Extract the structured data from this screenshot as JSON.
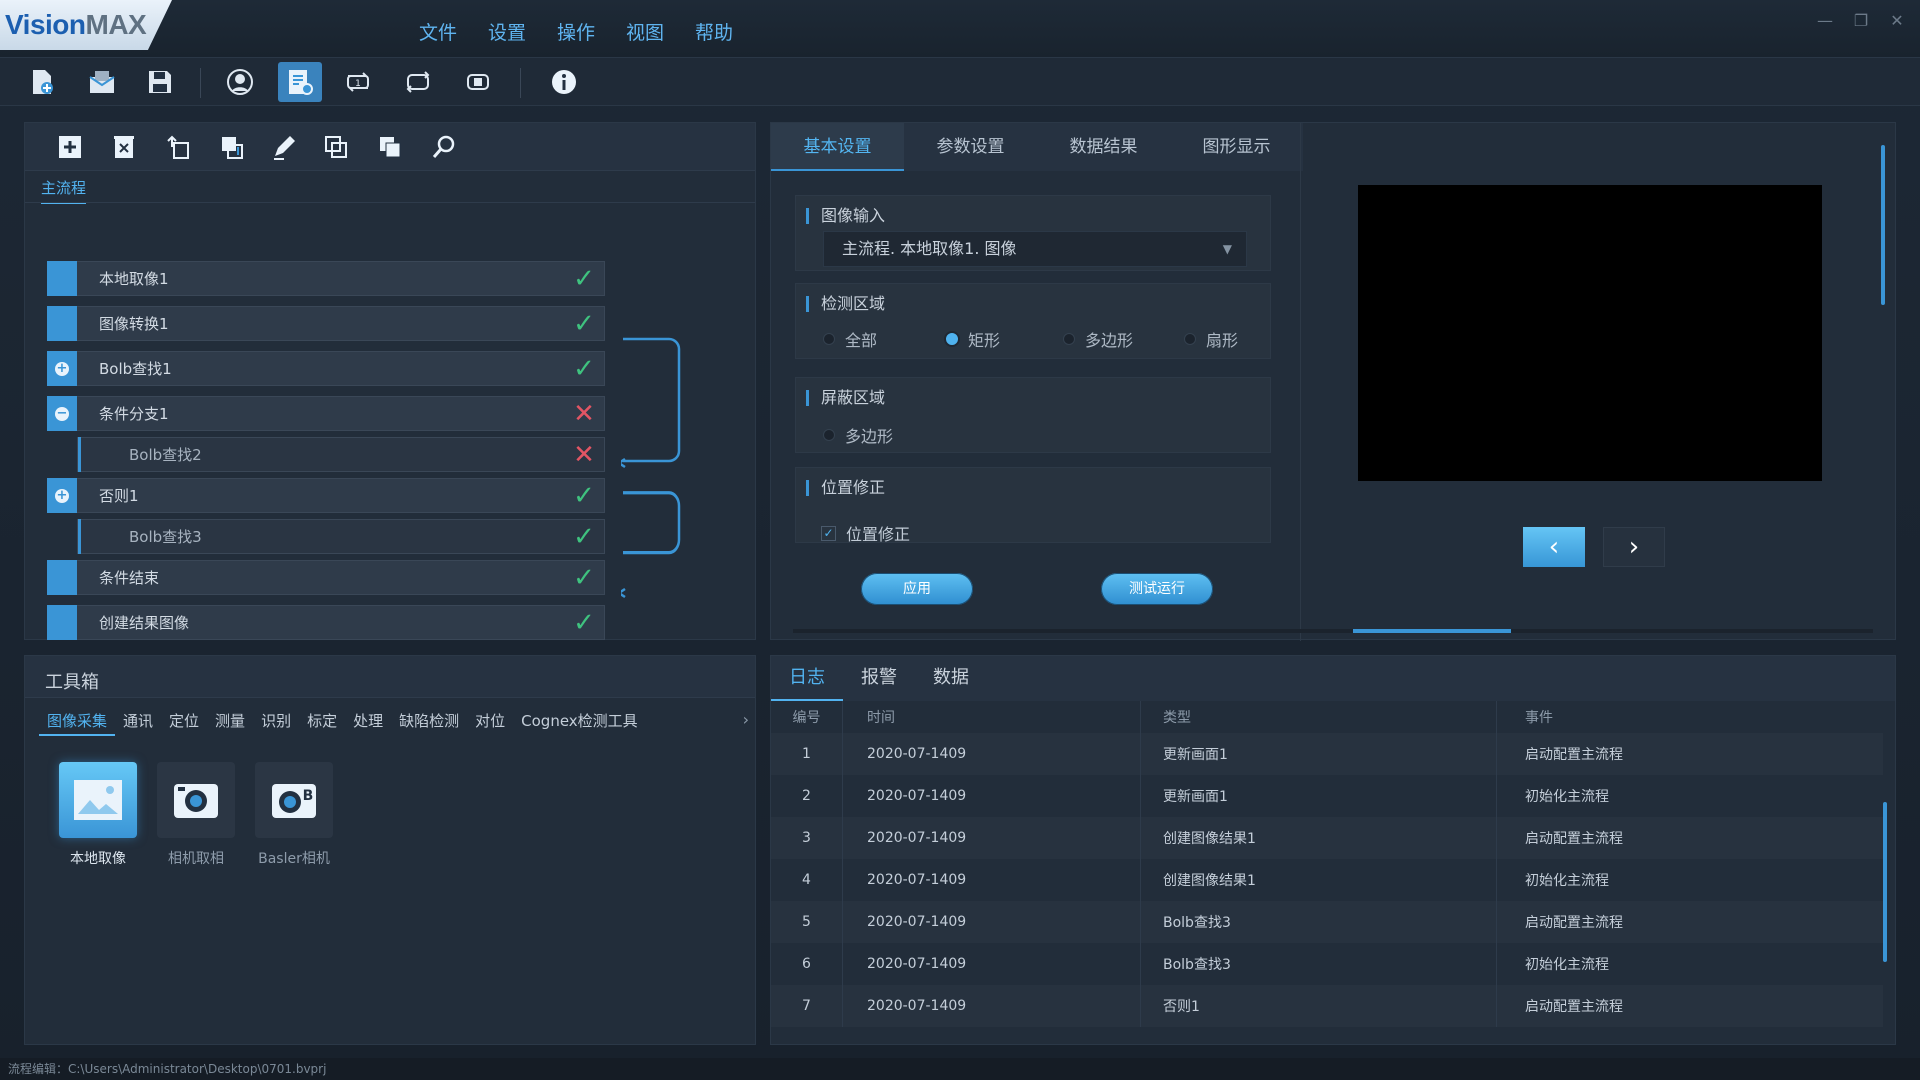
{
  "app": {
    "logo_part1": "Vision",
    "logo_part2": "MAX"
  },
  "menu": [
    "文件",
    "设置",
    "操作",
    "视图",
    "帮助"
  ],
  "flow": {
    "tab": "主流程",
    "nodes": [
      {
        "label": "本地取像1",
        "status": "ok",
        "type": "plain"
      },
      {
        "label": "图像转换1",
        "status": "ok",
        "type": "plain"
      },
      {
        "label": "Bolb查找1",
        "status": "ok",
        "type": "plus"
      },
      {
        "label": "条件分支1",
        "status": "fail",
        "type": "minus"
      },
      {
        "label": "Bolb查找2",
        "status": "fail",
        "type": "child"
      },
      {
        "label": "否则1",
        "status": "ok",
        "type": "plus"
      },
      {
        "label": "Bolb查找3",
        "status": "ok",
        "type": "child"
      },
      {
        "label": "条件结束",
        "status": "ok",
        "type": "plain"
      },
      {
        "label": "创建结果图像",
        "status": "ok",
        "type": "plain"
      }
    ]
  },
  "settings": {
    "tabs": [
      "基本设置",
      "参数设置",
      "数据结果",
      "图形显示"
    ],
    "image_input": {
      "title": "图像输入",
      "value": "主流程. 本地取像1. 图像"
    },
    "detect_region": {
      "title": "检测区域",
      "options": [
        "全部",
        "矩形",
        "多边形",
        "扇形"
      ],
      "selected": "矩形"
    },
    "mask_region": {
      "title": "屏蔽区域",
      "option": "多边形"
    },
    "position": {
      "title": "位置修正",
      "checkbox_label": "位置修正",
      "checked": true
    },
    "apply_label": "应用",
    "test_label": "测试运行"
  },
  "toolbox": {
    "title": "工具箱",
    "categories": [
      "图像采集",
      "通讯",
      "定位",
      "测量",
      "识别",
      "标定",
      "处理",
      "缺陷检测",
      "对位",
      "Cognex检测工具"
    ],
    "tools": [
      {
        "label": "本地取像",
        "icon": "image-icon"
      },
      {
        "label": "相机取相",
        "icon": "camera-icon"
      },
      {
        "label": "Basler相机",
        "icon": "basler-camera-icon"
      }
    ]
  },
  "log": {
    "tabs": [
      "日志",
      "报警",
      "数据"
    ],
    "columns": [
      "编号",
      "时间",
      "类型",
      "事件"
    ],
    "rows": [
      [
        "1",
        "2020-07-1409",
        "更新画面1",
        "启动配置主流程"
      ],
      [
        "2",
        "2020-07-1409",
        "更新画面1",
        "初始化主流程"
      ],
      [
        "3",
        "2020-07-1409",
        "创建图像结果1",
        "启动配置主流程"
      ],
      [
        "4",
        "2020-07-1409",
        "创建图像结果1",
        "初始化主流程"
      ],
      [
        "5",
        "2020-07-1409",
        "Bolb查找3",
        "启动配置主流程"
      ],
      [
        "6",
        "2020-07-1409",
        "Bolb查找3",
        "初始化主流程"
      ],
      [
        "7",
        "2020-07-1409",
        "否则1",
        "启动配置主流程"
      ]
    ]
  },
  "statusbar": {
    "text": "流程编辑：C:\\Users\\Administrator\\Desktop\\0701.bvprj"
  },
  "colors": {
    "accent": "#3a95d6",
    "ok": "#3fc27f",
    "fail": "#e25564",
    "bg": "#1a2330"
  }
}
